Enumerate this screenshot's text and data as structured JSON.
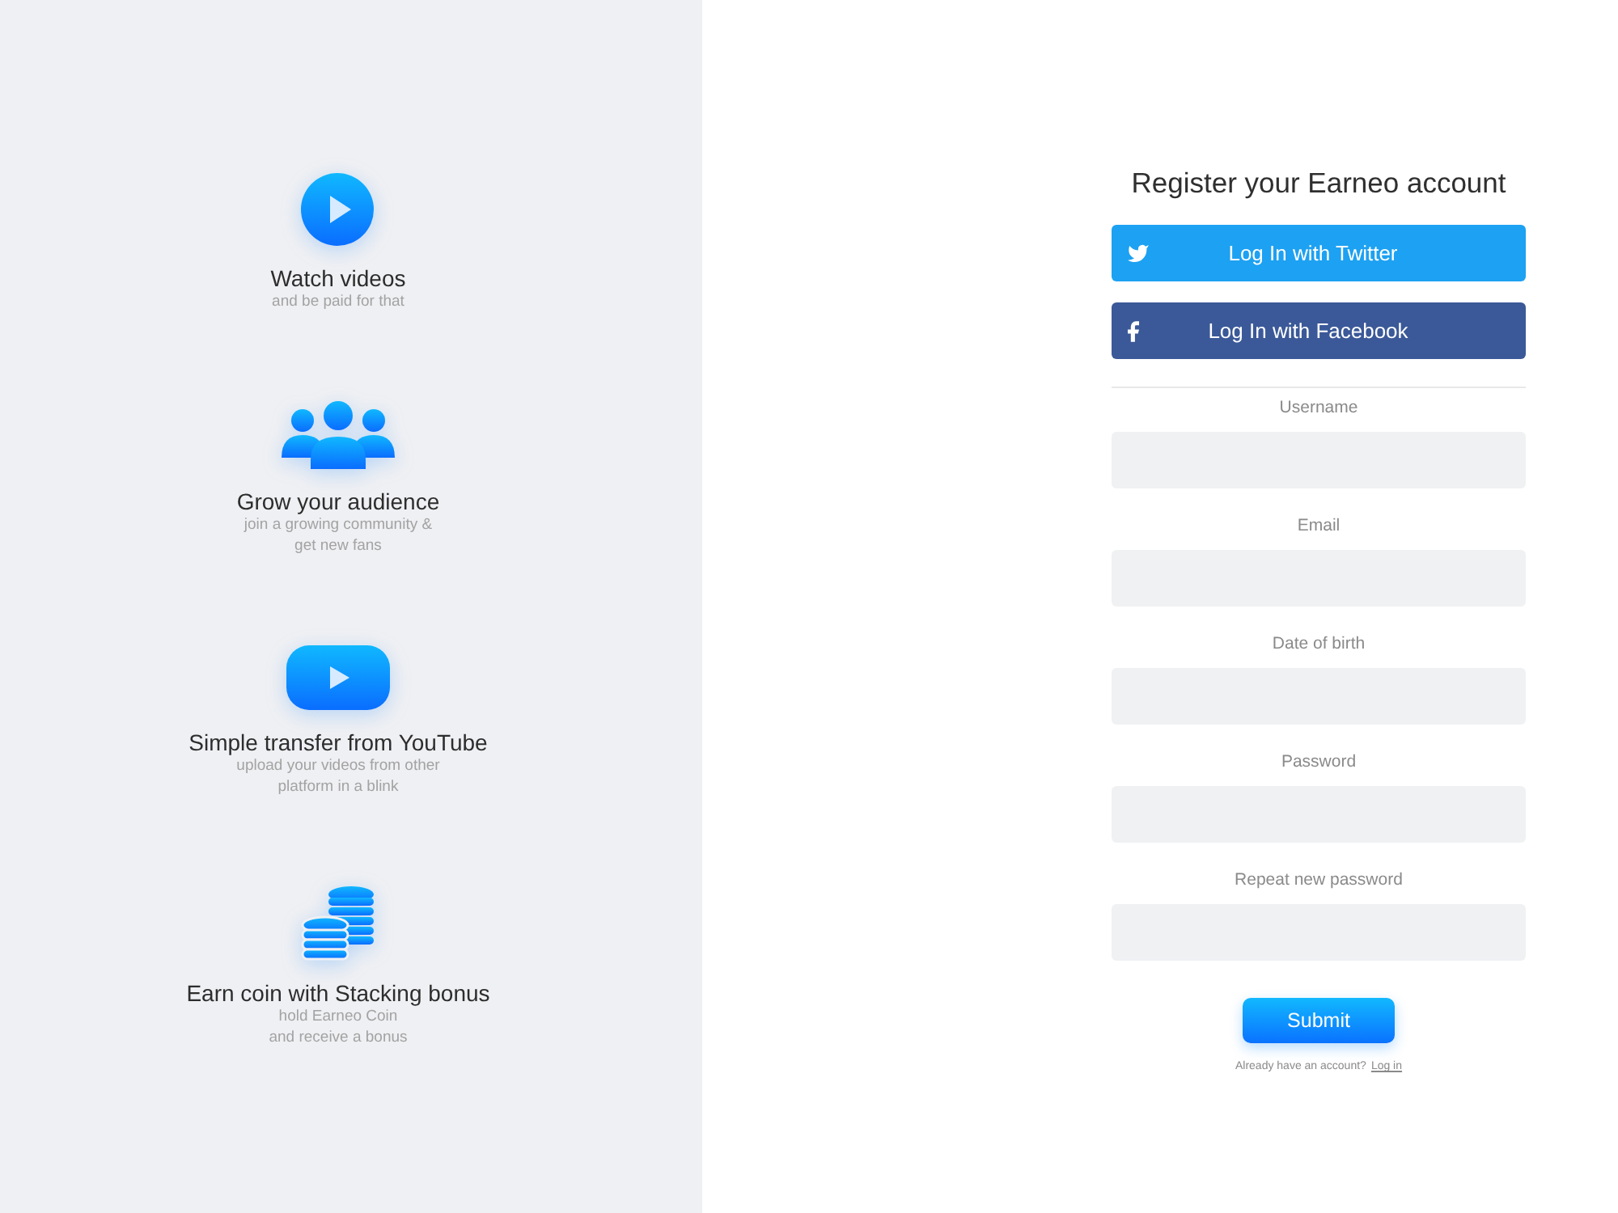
{
  "features": [
    {
      "kind": "play-circle",
      "title": "Watch videos",
      "subtitle": [
        "and be paid for that"
      ]
    },
    {
      "kind": "people",
      "title": "Grow your audience",
      "subtitle": [
        "join a growing community &",
        "get new fans"
      ]
    },
    {
      "kind": "video-player",
      "title": "Simple transfer from YouTube",
      "subtitle": [
        "upload your videos from other",
        "platform in a blink"
      ]
    },
    {
      "kind": "coins",
      "title": "Earn coin with Stacking bonus",
      "subtitle": [
        "hold Earneo Coin",
        "and receive a bonus"
      ]
    }
  ],
  "form": {
    "title": "Register your Earneo account",
    "social_buttons": [
      {
        "kind": "twitter",
        "label": "Log In with Twitter"
      },
      {
        "kind": "facebook",
        "label": "Log In with Facebook"
      }
    ],
    "fields": [
      {
        "label": "Username"
      },
      {
        "label": "Email"
      },
      {
        "label": "Date of birth"
      },
      {
        "label": "Password"
      },
      {
        "label": "Repeat new password"
      }
    ],
    "submit": "Submit",
    "footer": {
      "text": "Already have an account?",
      "link": "Log in"
    }
  }
}
